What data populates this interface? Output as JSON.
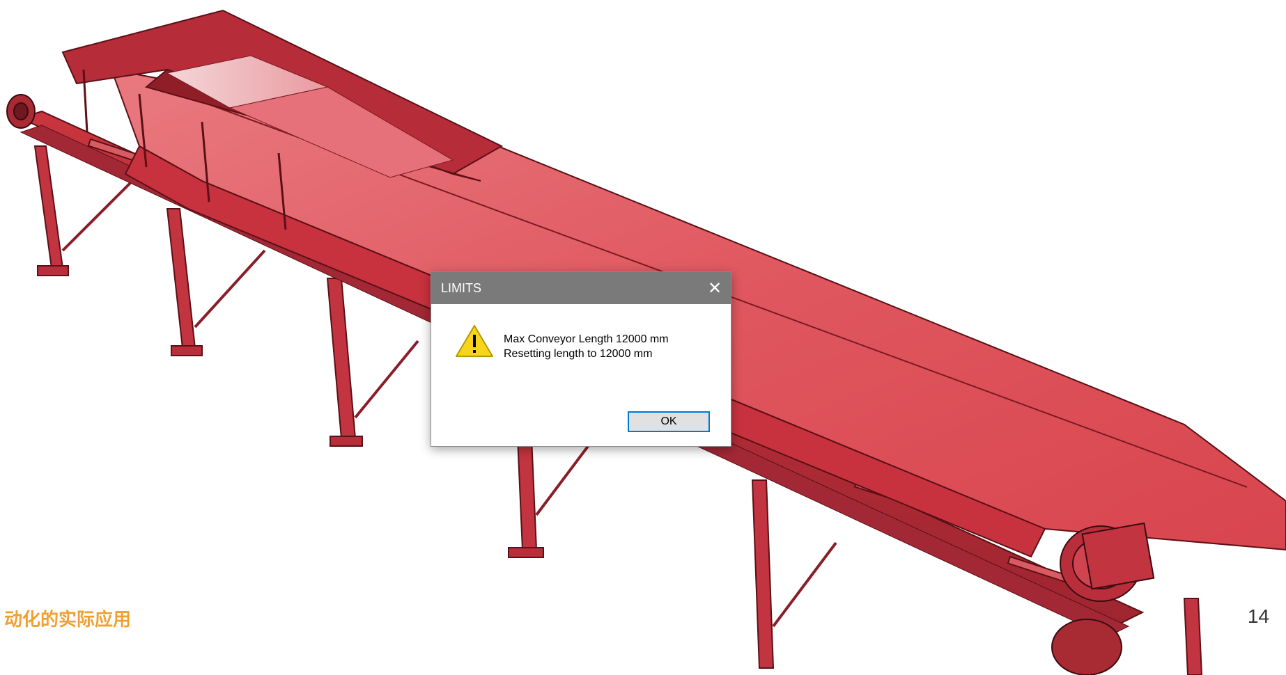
{
  "dialog": {
    "title": "LIMITS",
    "close_symbol": "✕",
    "icon": "warning-icon",
    "message_line1": "Max Conveyor Length 12000 mm",
    "message_line2": "Resetting length to 12000 mm",
    "ok_label": "OK"
  },
  "footer": {
    "caption": "动化的实际应用",
    "page_number": "14"
  },
  "colors": {
    "conveyor_red": "#d9454f",
    "conveyor_dark": "#a82a33",
    "caption_orange": "#f0a030",
    "titlebar_gray": "#7a7a7a",
    "button_focus_blue": "#0078d7"
  }
}
